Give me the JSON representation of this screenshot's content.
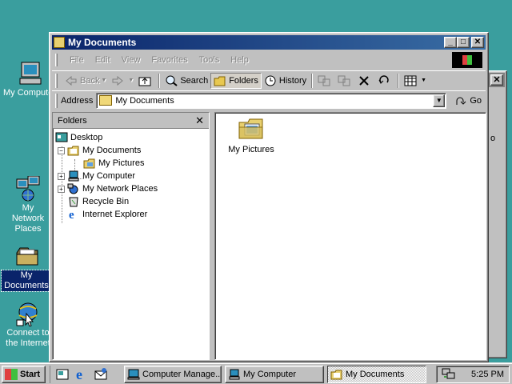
{
  "desktop": {
    "icons": [
      {
        "label": "My Computer"
      },
      {
        "label": "My Network Places"
      },
      {
        "label": "My Documents"
      },
      {
        "label": "Connect to the Internet"
      }
    ]
  },
  "bg_window": {
    "fragment": "o"
  },
  "window": {
    "title": "My Documents",
    "menu": [
      "File",
      "Edit",
      "View",
      "Favorites",
      "Tools",
      "Help"
    ],
    "toolbar": {
      "back": "Back",
      "search": "Search",
      "folders": "Folders",
      "history": "History"
    },
    "address": {
      "label": "Address",
      "value": "My Documents",
      "go": "Go"
    },
    "folders_pane": {
      "title": "Folders",
      "tree": [
        "Desktop",
        "My Documents",
        "My Pictures",
        "My Computer",
        "My Network Places",
        "Recycle Bin",
        "Internet Explorer"
      ]
    },
    "content": {
      "items": [
        {
          "label": "My Pictures"
        }
      ]
    }
  },
  "taskbar": {
    "start": "Start",
    "tasks": [
      "Computer Manage...",
      "My Computer",
      "My Documents"
    ],
    "clock": "5:25 PM"
  }
}
